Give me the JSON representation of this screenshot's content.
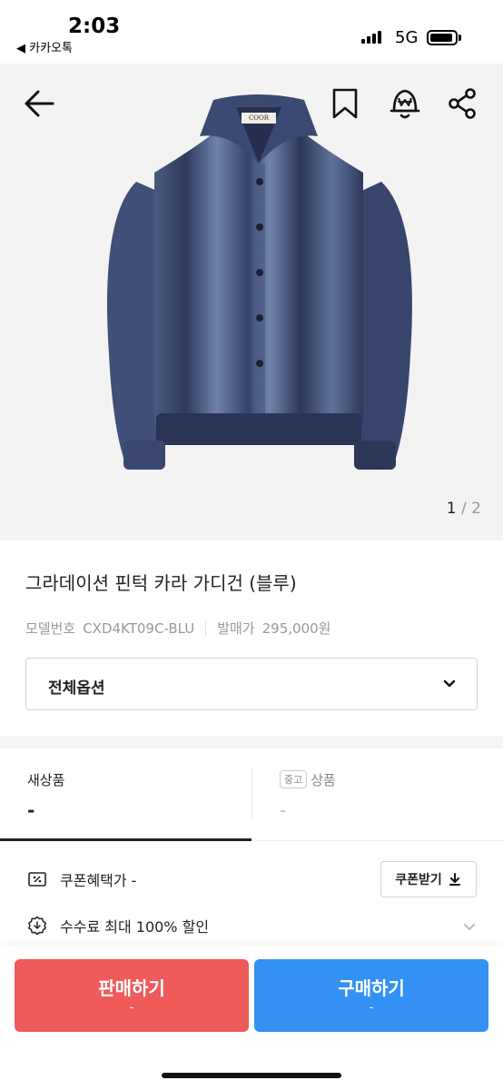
{
  "status_bar": {
    "time": "2:03",
    "back_app": "◀ 카카오톡",
    "network": "5G"
  },
  "product": {
    "pager_current": "1",
    "pager_separator": " / ",
    "pager_total": "2",
    "title": "그라데이션 핀턱 카라 가디건 (블루)",
    "model_label": "모델번호",
    "model_value": "CXD4KT09C-BLU",
    "release_label": "발매가",
    "release_value": "295,000원",
    "label_text": "COOR"
  },
  "options": {
    "label": "전체옵션"
  },
  "tabs": {
    "new": {
      "label": "새상품",
      "price": "-"
    },
    "used": {
      "badge": "중고",
      "label": "상품",
      "price": "-"
    }
  },
  "benefits": {
    "coupon_label": "쿠폰혜택가 -",
    "coupon_button": "쿠폰받기",
    "fee_label": "수수료 최대 100% 할인"
  },
  "actions": {
    "sell_label": "판매하기",
    "sell_sub": "-",
    "buy_label": "구매하기",
    "buy_sub": "-"
  },
  "colors": {
    "sell": "#ef5a5a",
    "buy": "#3391f3",
    "cardigan_dark": "#2f3b5c",
    "cardigan_light": "#6b7fa3"
  }
}
